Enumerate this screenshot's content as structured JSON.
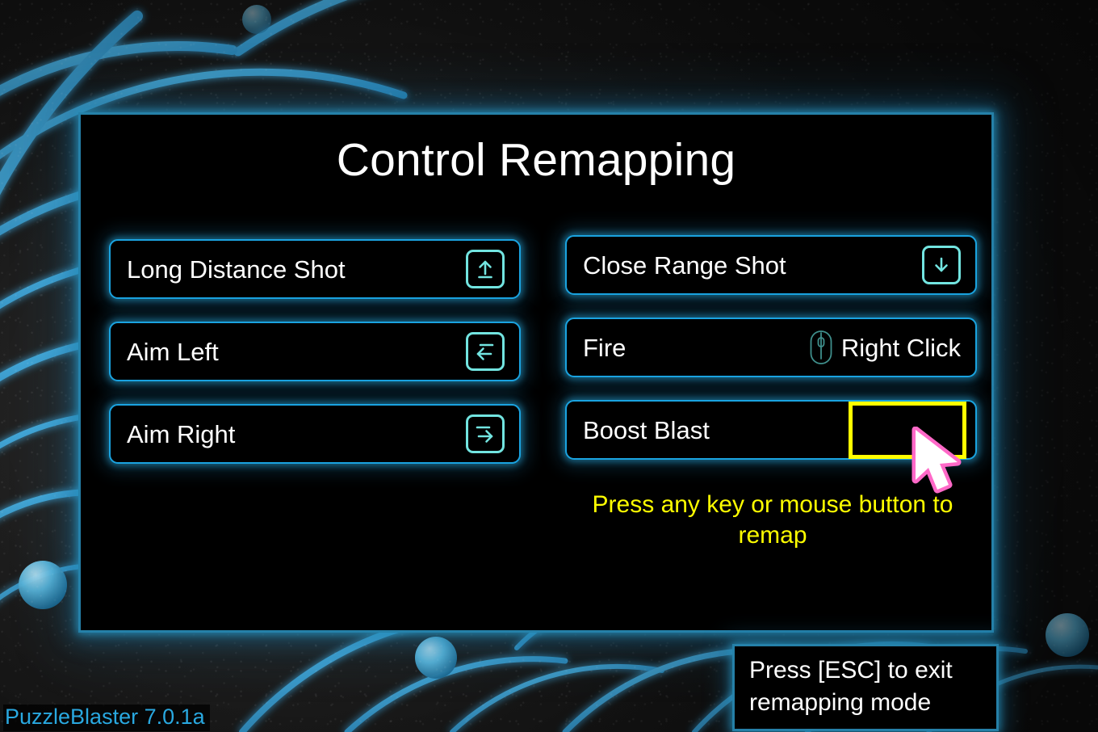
{
  "app": {
    "version_watermark": "PuzzleBlaster 7.0.1a"
  },
  "panel": {
    "title": "Control Remapping"
  },
  "colors": {
    "panel_border": "#1aa3e0",
    "glow": "#2696c3",
    "key_icon": "#72e4e0",
    "mouse_icon": "#3f8f8c",
    "highlight": "#ffff00",
    "cursor_outline": "#ff69c8",
    "cursor_fill": "#ffffff",
    "title_text": "#ffffff",
    "version_text": "#29a8e0",
    "background": "#1d1d1d",
    "arc_blue": "#3fa9dc"
  },
  "bindings": {
    "left_column": [
      {
        "action": "Long Distance Shot",
        "binding_kind": "key",
        "icon": "arrow-up-key-icon",
        "binding_text": ""
      },
      {
        "action": "Aim Left",
        "binding_kind": "key",
        "icon": "arrow-left-key-icon",
        "binding_text": ""
      },
      {
        "action": "Aim Right",
        "binding_kind": "key",
        "icon": "arrow-right-key-icon",
        "binding_text": ""
      }
    ],
    "right_column": [
      {
        "action": "Close Range Shot",
        "binding_kind": "key",
        "icon": "arrow-down-key-icon",
        "binding_text": ""
      },
      {
        "action": "Fire",
        "binding_kind": "mouse",
        "icon": "mouse-icon",
        "binding_text": "Right Click"
      },
      {
        "action": "Boost Blast",
        "binding_kind": "capture",
        "icon": "",
        "binding_text": ""
      }
    ]
  },
  "hints": {
    "remap_prompt": "Press any key or mouse button to remap",
    "esc_line1": "Press [ESC] to exit",
    "esc_line2": "remapping mode"
  }
}
